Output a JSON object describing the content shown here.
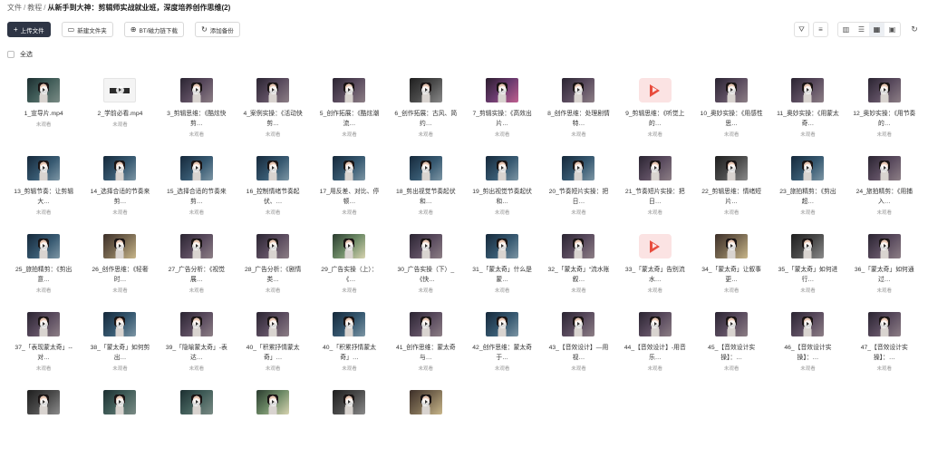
{
  "breadcrumb": {
    "root": "文件",
    "parent": "教程",
    "current": "从新手到大神：剪辑师实战就业班，深度培养创作思维(2)"
  },
  "toolbar": {
    "upload_label": "上传文件",
    "new_folder_label": "新建文件夹",
    "bt_label": "BT/磁力链下载",
    "backup_label": "添加备份"
  },
  "select_all_label": "全选",
  "status_text": "未观看",
  "files": [
    {
      "name": "1_宣导片.mp4",
      "thumb": "v1"
    },
    {
      "name": "2_学前必看.mp4",
      "thumb": "white"
    },
    {
      "name": "3_剪辑思维：《酷炫快剪…",
      "thumb": "v2"
    },
    {
      "name": "4_案例实操：《活动快剪…",
      "thumb": "v2"
    },
    {
      "name": "5_创作拓展：《酷炫潮流…",
      "thumb": "v2"
    },
    {
      "name": "6_创作拓展：古风、简约…",
      "thumb": "v4"
    },
    {
      "name": "7_剪辑实操：《高效出片…",
      "thumb": "v5"
    },
    {
      "name": "8_创作思维：处理剧情特…",
      "thumb": "v2"
    },
    {
      "name": "9_剪辑思维：《听觉上的…",
      "thumb": "pdf"
    },
    {
      "name": "10_奥妙实操：《用感性思…",
      "thumb": "v2"
    },
    {
      "name": "11_奥妙实操：《用蒙太奇…",
      "thumb": "v2"
    },
    {
      "name": "12_奥妙实操：《用节奏的…",
      "thumb": "v2"
    },
    {
      "name": "13_剪辑节奏：让剪辑大…",
      "thumb": "v3"
    },
    {
      "name": "14_选择合适的节奏来剪…",
      "thumb": "v3"
    },
    {
      "name": "15_选择合适的节奏来剪…",
      "thumb": "v3"
    },
    {
      "name": "16_控制情绪节奏起伏、…",
      "thumb": "v3"
    },
    {
      "name": "17_用反差、对比、停顿…",
      "thumb": "v3"
    },
    {
      "name": "18_剪出视觉节奏起伏和…",
      "thumb": "v3"
    },
    {
      "name": "19_剪出视觉节奏起伏和…",
      "thumb": "v3"
    },
    {
      "name": "20_节奏短片实操：把日…",
      "thumb": "v3"
    },
    {
      "name": "21_节奏短片实操：把日…",
      "thumb": "v2"
    },
    {
      "name": "22_剪辑思维：情绪短片…",
      "thumb": "v4"
    },
    {
      "name": "23_旅拍精剪：《剪出超…",
      "thumb": "v3"
    },
    {
      "name": "24_旅拍精剪：《用捕入…",
      "thumb": "v2"
    },
    {
      "name": "25_旅拍精剪：《剪出意…",
      "thumb": "v3"
    },
    {
      "name": "26_创作思维：《轻奢时…",
      "thumb": "v6"
    },
    {
      "name": "27_广告分析：《视觉展…",
      "thumb": "v2"
    },
    {
      "name": "28_广告分析：《剧情类…",
      "thumb": "v2"
    },
    {
      "name": "29_广告实操（上）：《…",
      "thumb": "v7"
    },
    {
      "name": "30_广告实操（下）_《快…",
      "thumb": "v2"
    },
    {
      "name": "31_「蒙太奇」什么是蒙…",
      "thumb": "v3"
    },
    {
      "name": "32_「蒙太奇」“流水账叙…",
      "thumb": "v2"
    },
    {
      "name": "33_「蒙太奇」告别流水…",
      "thumb": "pdf"
    },
    {
      "name": "34_「蒙太奇」让叙事更…",
      "thumb": "v6"
    },
    {
      "name": "35_「蒙太奇」如何进行…",
      "thumb": "v4"
    },
    {
      "name": "36_「蒙太奇」如何通过…",
      "thumb": "v2"
    },
    {
      "name": "37_「表现蒙太奇」--对…",
      "thumb": "v2"
    },
    {
      "name": "38_「蒙太奇」如何剪出…",
      "thumb": "v3"
    },
    {
      "name": "39_「隐喻蒙太奇」-表达…",
      "thumb": "v2"
    },
    {
      "name": "40_「积累抒情蒙太奇」…",
      "thumb": "v2"
    },
    {
      "name": "40_「积累抒情蒙太奇」…",
      "thumb": "v3"
    },
    {
      "name": "41_创作思维：蒙太奇与…",
      "thumb": "v2"
    },
    {
      "name": "42_创作思维：蒙太奇于…",
      "thumb": "v3"
    },
    {
      "name": "43_【音效设计】—用视…",
      "thumb": "v2"
    },
    {
      "name": "44_【音效设计】-用音乐…",
      "thumb": "v2"
    },
    {
      "name": "45_【音效设计实操】：…",
      "thumb": "v2"
    },
    {
      "name": "46_【音效设计实操】：…",
      "thumb": "v2"
    },
    {
      "name": "47_【音效设计实操】：…",
      "thumb": "v2"
    },
    {
      "thumb": "v4"
    },
    {
      "thumb": "v1"
    },
    {
      "thumb": "v1"
    },
    {
      "thumb": "v7"
    },
    {
      "thumb": "v4"
    },
    {
      "thumb": "v6"
    }
  ]
}
